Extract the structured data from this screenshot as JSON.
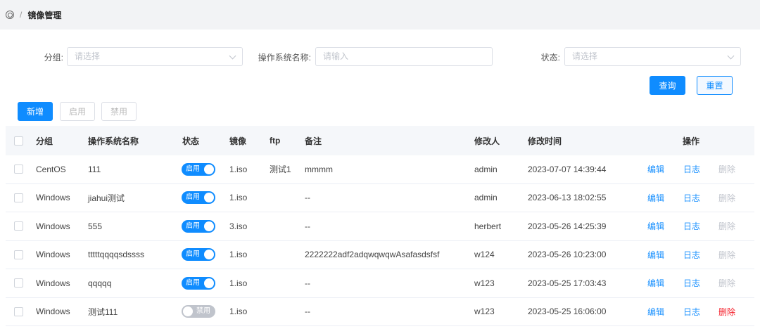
{
  "breadcrumb": {
    "current": "镜像管理"
  },
  "filters": {
    "group_label": "分组:",
    "group_placeholder": "请选择",
    "os_label": "操作系统名称:",
    "os_placeholder": "请输入",
    "status_label": "状态:",
    "status_placeholder": "请选择"
  },
  "actions": {
    "query": "查询",
    "reset": "重置",
    "add": "新增",
    "enable": "启用",
    "disable": "禁用"
  },
  "table": {
    "headers": {
      "group": "分组",
      "os": "操作系统名称",
      "status": "状态",
      "image": "镜像",
      "ftp": "ftp",
      "remark": "备注",
      "modifier": "修改人",
      "time": "修改时间",
      "ops": "操作"
    },
    "rows": [
      {
        "group": "CentOS",
        "os": "111",
        "status": "启用",
        "enabled": true,
        "image": "1.iso",
        "ftp": "测试1",
        "remark": "mmmm",
        "modifier": "admin",
        "time": "2023-07-07 14:39:44",
        "edit": "编辑",
        "log": "日志",
        "del": "删除",
        "del_active": false
      },
      {
        "group": "Windows",
        "os": "jiahui测试",
        "status": "启用",
        "enabled": true,
        "image": "1.iso",
        "ftp": "",
        "remark": "--",
        "modifier": "admin",
        "time": "2023-06-13 18:02:55",
        "edit": "编辑",
        "log": "日志",
        "del": "删除",
        "del_active": false
      },
      {
        "group": "Windows",
        "os": "555",
        "status": "启用",
        "enabled": true,
        "image": "3.iso",
        "ftp": "",
        "remark": "--",
        "modifier": "herbert",
        "time": "2023-05-26 14:25:39",
        "edit": "编辑",
        "log": "日志",
        "del": "删除",
        "del_active": false
      },
      {
        "group": "Windows",
        "os": "tttttqqqqsdssss",
        "status": "启用",
        "enabled": true,
        "image": "1.iso",
        "ftp": "",
        "remark": "2222222adf2adqwqwqwAsafasdsfsf",
        "modifier": "w124",
        "time": "2023-05-26 10:23:00",
        "edit": "编辑",
        "log": "日志",
        "del": "删除",
        "del_active": false
      },
      {
        "group": "Windows",
        "os": "qqqqq",
        "status": "启用",
        "enabled": true,
        "image": "1.iso",
        "ftp": "",
        "remark": "--",
        "modifier": "w123",
        "time": "2023-05-25 17:03:43",
        "edit": "编辑",
        "log": "日志",
        "del": "删除",
        "del_active": false
      },
      {
        "group": "Windows",
        "os": "测试111",
        "status": "禁用",
        "enabled": false,
        "image": "1.iso",
        "ftp": "",
        "remark": "--",
        "modifier": "w123",
        "time": "2023-05-25 16:06:00",
        "edit": "编辑",
        "log": "日志",
        "del": "删除",
        "del_active": true
      }
    ]
  }
}
